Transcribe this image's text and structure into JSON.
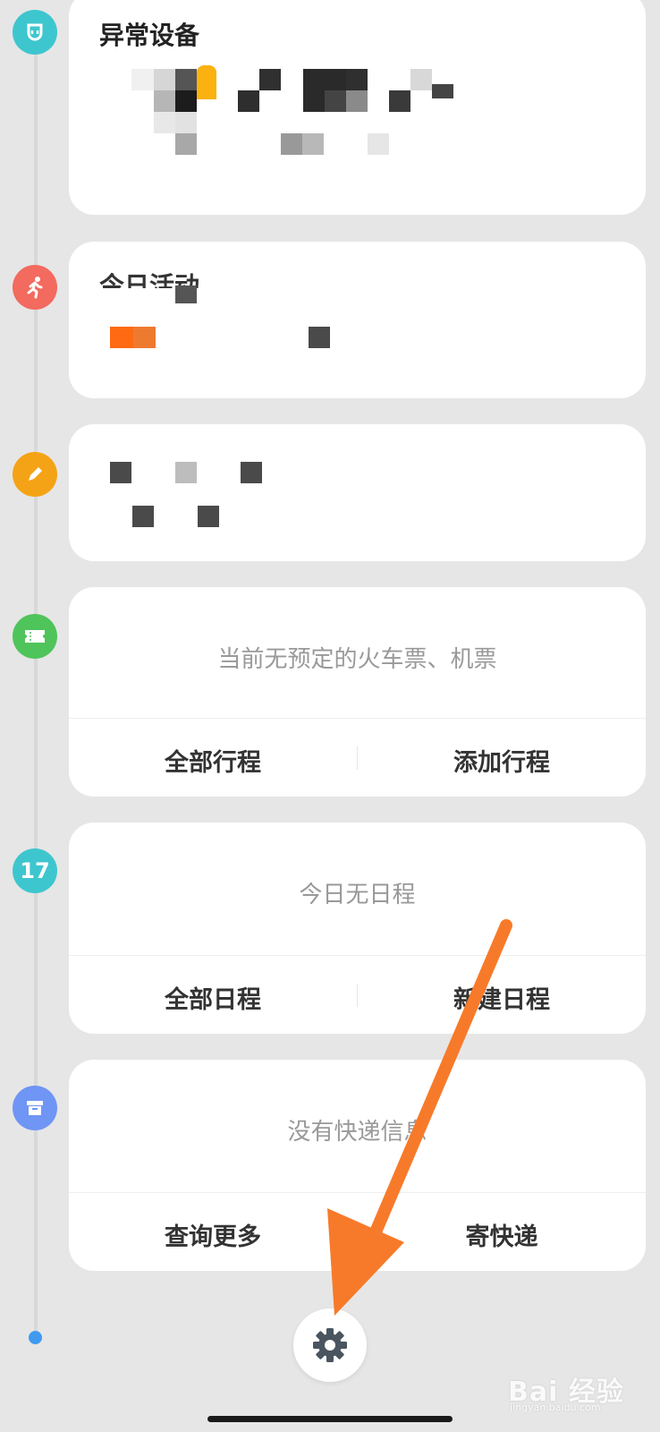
{
  "colors": {
    "mi_icon": "#3ec6cf",
    "run_icon": "#f36a5f",
    "pencil_icon": "#f5a316",
    "ticket_icon": "#4fc45b",
    "calendar_icon": "#3ec6cf",
    "box_icon": "#6f95f5",
    "timeline_end": "#3f9af0",
    "arrow": "#f77a2a"
  },
  "icons": [
    "mi-home-icon",
    "running-icon",
    "pencil-icon",
    "ticket-icon",
    "calendar-icon",
    "package-icon",
    "gear-icon"
  ],
  "abnormal_devices": {
    "title": "异常设备"
  },
  "today_activity": {
    "title": "今日活动"
  },
  "travel": {
    "empty_text": "当前无预定的火车票、机票",
    "actions": [
      "全部行程",
      "添加行程"
    ]
  },
  "schedule": {
    "icon_text": "17",
    "empty_text": "今日无日程",
    "actions": [
      "全部日程",
      "新建日程"
    ]
  },
  "express": {
    "empty_text": "没有快递信息",
    "actions": [
      "查询更多",
      "寄快递"
    ]
  },
  "watermark": {
    "text": "Bai 经验",
    "sub": "jingyan.baidu.com"
  }
}
